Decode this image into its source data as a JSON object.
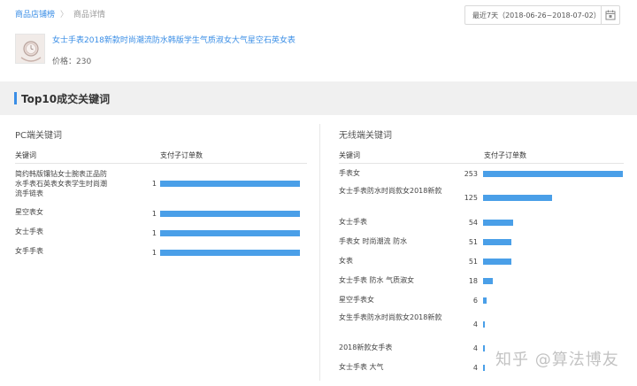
{
  "breadcrumb": {
    "link": "商品店铺榜",
    "separator": "〉",
    "current": "商品详情"
  },
  "date_range": {
    "label": "最近7天（2018-06-26~2018-07-02）",
    "icon": "calendar-icon"
  },
  "product": {
    "title": "女士手表2018新款时尚潮流防水韩版学生气质淑女大气星空石英女表",
    "price_label": "价格：",
    "price": "230"
  },
  "section": {
    "title": "Top10成交关键词"
  },
  "pc": {
    "title": "PC端关键词",
    "col_keyword": "关键词",
    "col_orders": "支付子订单数",
    "rows": [
      {
        "keyword": "简约韩版镶钻女士腕表正品防水手表石英表女表学生时尚潮流手链表",
        "value": 1
      },
      {
        "keyword": "星空表女",
        "value": 1
      },
      {
        "keyword": "女士手表",
        "value": 1
      },
      {
        "keyword": "女手手表",
        "value": 1
      }
    ]
  },
  "mobile": {
    "title": "无线端关键词",
    "col_keyword": "关键词",
    "col_orders": "支付子订单数",
    "rows": [
      {
        "keyword": "手表女",
        "value": 253
      },
      {
        "keyword": "女士手表防水时尚款女2018新款",
        "value": 125
      },
      {
        "keyword": "女士手表",
        "value": 54
      },
      {
        "keyword": "手表女 时尚潮流 防水",
        "value": 51
      },
      {
        "keyword": "女表",
        "value": 51
      },
      {
        "keyword": "女士手表 防水 气质淑女",
        "value": 18
      },
      {
        "keyword": "星空手表女",
        "value": 6
      },
      {
        "keyword": "女生手表防水时尚款女2018新款",
        "value": 4
      },
      {
        "keyword": "2018新款女手表",
        "value": 4
      },
      {
        "keyword": "女士手表 大气",
        "value": 4
      }
    ]
  },
  "watermark": "知乎 @算法博友",
  "colors": {
    "accent": "#3a8ee6",
    "bar": "#4a9fe8"
  }
}
